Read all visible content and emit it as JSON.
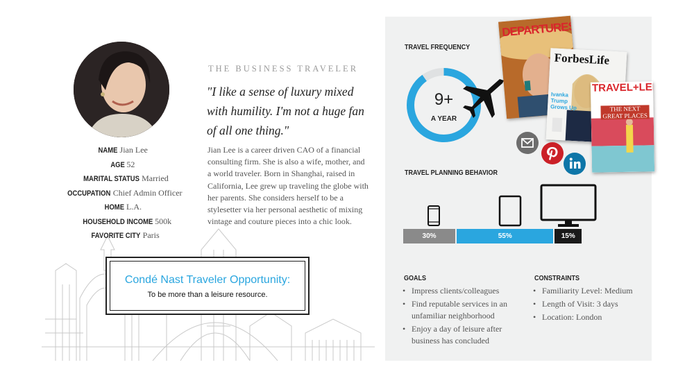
{
  "persona": {
    "photo_icon": "persona-photo",
    "stats": [
      {
        "key": "NAME",
        "value": "Jian Lee"
      },
      {
        "key": "AGE",
        "value": "52"
      },
      {
        "key": "MARITAL STATUS",
        "value": "Married"
      },
      {
        "key": "OCCUPATION",
        "value": "Chief Admin Officer"
      },
      {
        "key": "HOME",
        "value": "L.A."
      },
      {
        "key": "HOUSEHOLD INCOME",
        "value": "500k"
      },
      {
        "key": "FAVORITE CITY",
        "value": "Paris"
      }
    ],
    "kicker": "THE BUSINESS TRAVELER",
    "quote": "\"I like a sense of luxury mixed with humility. I'm not a huge fan of all one thing.\"",
    "bio": "Jian Lee is a career driven CAO of a financial consulting firm. She is also a wife, mother, and a world traveler. Born in Shanghai, raised in California, Lee grew up traveling the globe with her parents. She considers herself to be a stylesetter via her personal aesthetic of mixing vintage and couture pieces into a chic look."
  },
  "opportunity": {
    "title": "Condé Nast Traveler Opportunity:",
    "text": "To be more than a leisure resource."
  },
  "travel_frequency": {
    "label": "TRAVEL FREQUENCY",
    "value": "9+",
    "unit": "A YEAR",
    "ring_fill_fraction": 0.9,
    "ring_color": "#2aa6df",
    "icon": "airplane-icon"
  },
  "magazines": [
    {
      "title": "DEPARTURES",
      "icon": "departures-cover"
    },
    {
      "title": "ForbesLife",
      "cover_text": "Ivanka Trump Grows Up",
      "icon": "forbeslife-cover"
    },
    {
      "title": "TRAVEL+LEISURE",
      "cover_text": "THE NEXT GREAT PLACES",
      "icon": "travel-leisure-cover"
    }
  ],
  "social": [
    {
      "name": "email-icon",
      "color": "#6d6d6d"
    },
    {
      "name": "pinterest-icon",
      "color": "#cb2027"
    },
    {
      "name": "linkedin-icon",
      "color": "#0e76a8"
    }
  ],
  "planning": {
    "label": "TRAVEL PLANNING BEHAVIOR",
    "devices": [
      {
        "icon": "phone-icon",
        "share": "30%",
        "fraction": 0.3,
        "color": "#8a8a8a"
      },
      {
        "icon": "tablet-icon",
        "share": "55%",
        "fraction": 0.55,
        "color": "#2aa6df"
      },
      {
        "icon": "desktop-icon",
        "share": "15%",
        "fraction": 0.15,
        "color": "#1a1a1a"
      }
    ]
  },
  "goals": {
    "label": "GOALS",
    "items": [
      "Impress clients/colleagues",
      "Find reputable services in an unfamiliar neighborhood",
      "Enjoy a day of leisure after business has concluded"
    ]
  },
  "constraints": {
    "label": "CONSTRAINTS",
    "items": [
      "Familiarity Level: Medium",
      "Length of Visit: 3 days",
      "Location: London"
    ]
  }
}
